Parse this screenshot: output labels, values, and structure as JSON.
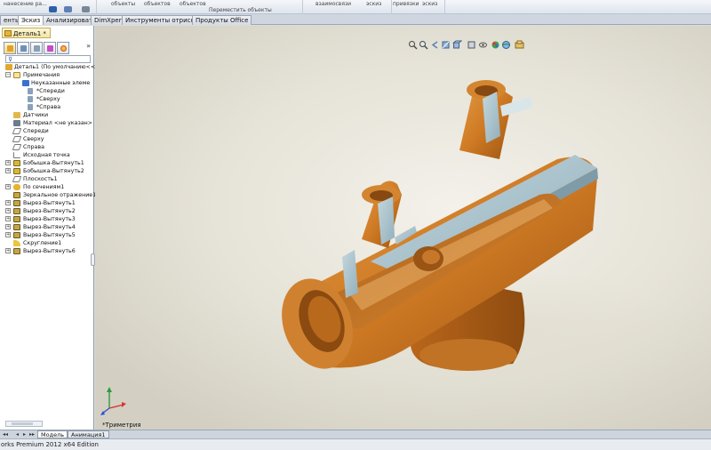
{
  "ribbon": {
    "items": [
      "нанесение ра...",
      "объекты",
      "объектов",
      "объектов",
      "Переместить объекты",
      "взаимосвязи",
      "эскиз",
      "привязки",
      "эскиз"
    ]
  },
  "command_tabs": [
    "енты",
    "Эскиз",
    "Анализировать",
    "DimXpert",
    "Инструменты отрисовки",
    "Продукты Office"
  ],
  "document_tab": "Деталь1 *",
  "feature_tree": {
    "root": "Деталь1  (По умолчанию<<П",
    "items": [
      "Примечания",
      "Неуказанные элеме",
      "*Спереди",
      "*Сверху",
      "*Справа",
      "Датчики",
      "Материал <не указан>",
      "Спереди",
      "Сверху",
      "Справа",
      "Исходная точка",
      "Бобышка-Вытянуть1",
      "Бобышка-Вытянуть2",
      "Плоскость1",
      "По сечениям1",
      "Зеркальное отражение1",
      "Вырез-Вытянуть1",
      "Вырез-Вытянуть2",
      "Вырез-Вытянуть3",
      "Вырез-Вытянуть4",
      "Вырез-Вытянуть5",
      "Скругление1",
      "Вырез-Вытянуть6"
    ]
  },
  "bottom_tabs": [
    "Модель",
    "Анимация1"
  ],
  "view_orientation": "*Триметрия",
  "status_bar": "orks Premium 2012 x64 Edition",
  "colors": {
    "model_orange": "#cf7a24",
    "section_face": "#a9c3cc",
    "selection_blue": "#2a5db0"
  }
}
